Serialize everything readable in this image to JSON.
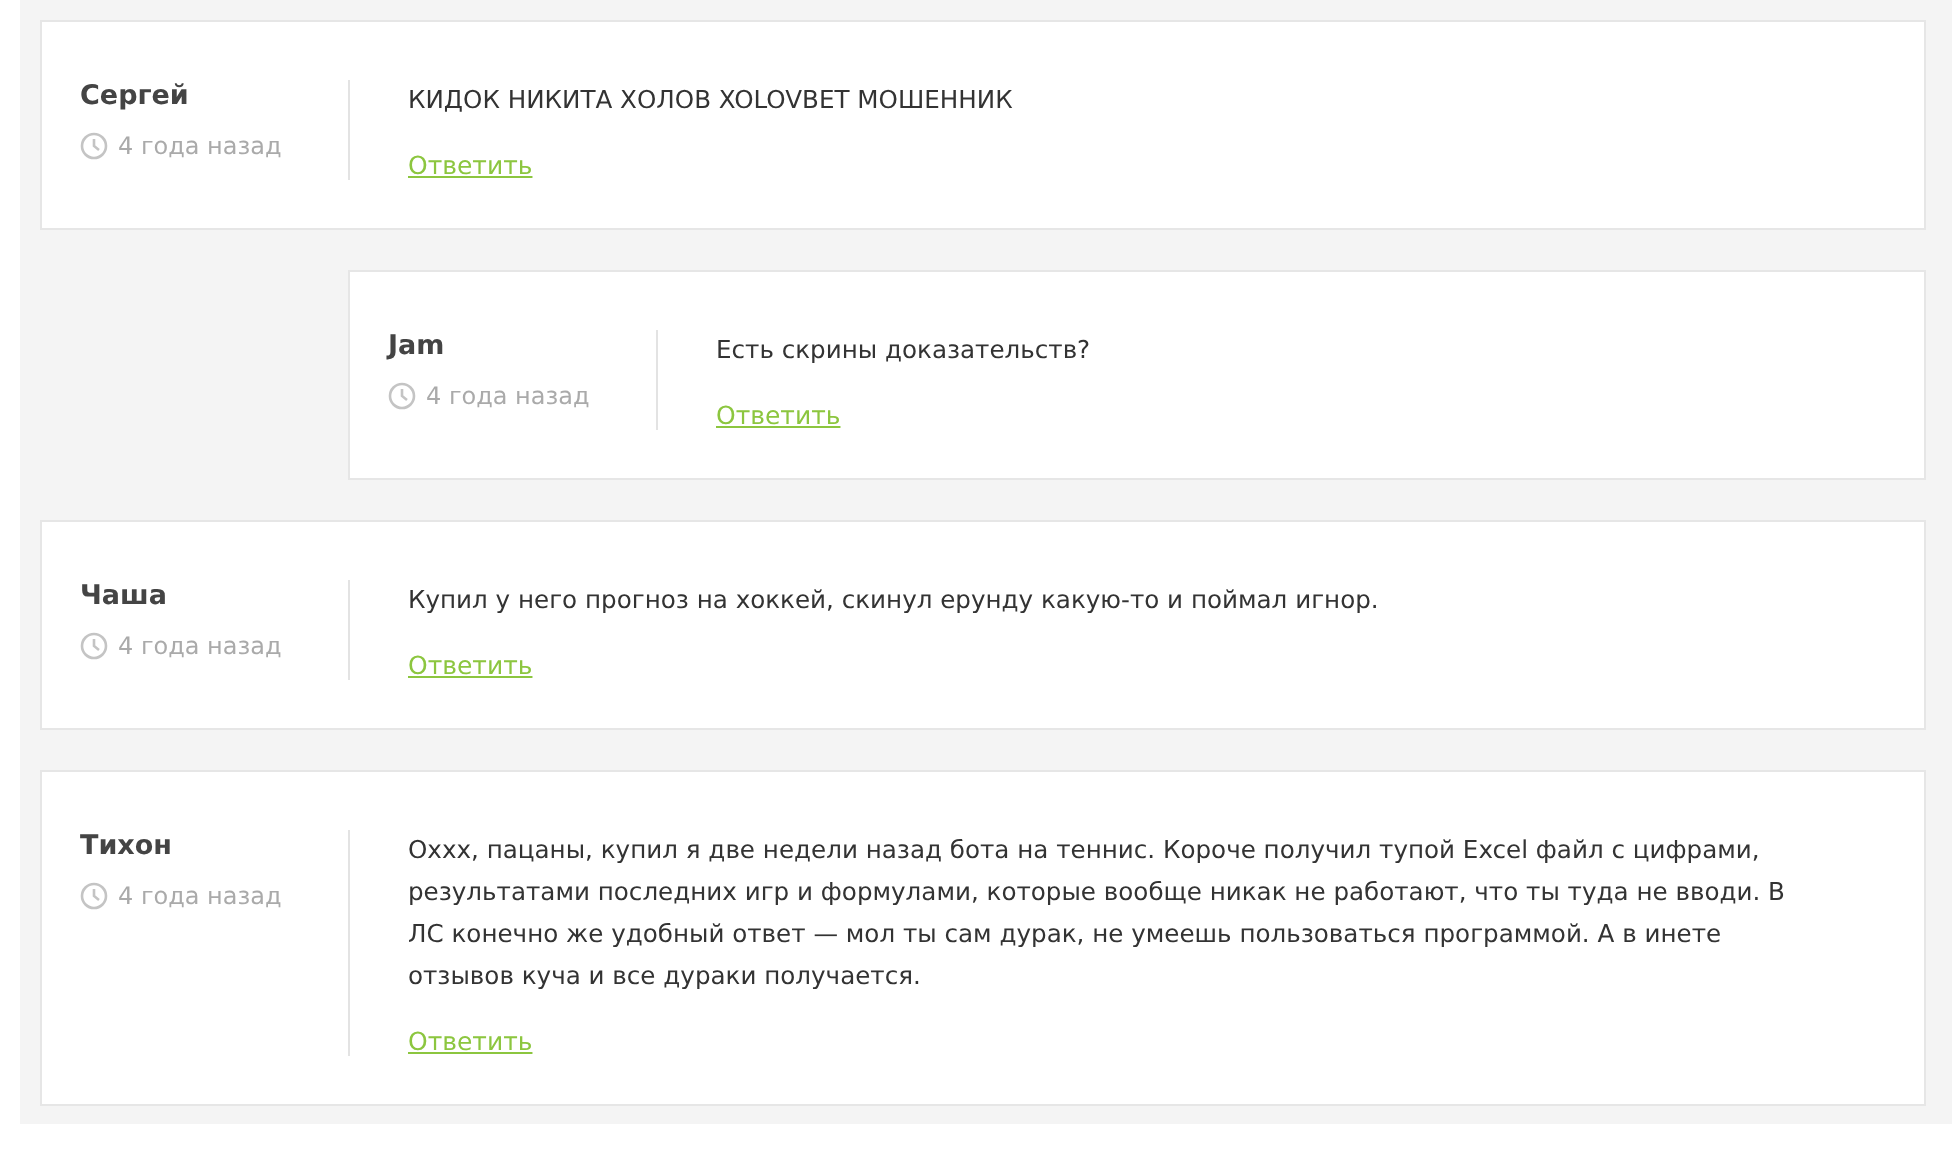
{
  "comments": [
    {
      "author": "Сергей",
      "time": "4 года назад",
      "text": "КИДОК НИКИТА ХОЛОВ XOLOVBET МОШЕННИК",
      "reply_label": "Ответить",
      "children": [
        {
          "author": "Jam",
          "time": "4 года назад",
          "text": "Есть скрины доказательств?",
          "reply_label": "Ответить"
        }
      ]
    },
    {
      "author": "Чаша",
      "time": "4 года назад",
      "text": "Купил у него прогноз на хоккей, скинул ерунду какую-то и поймал игнор.",
      "reply_label": "Ответить"
    },
    {
      "author": "Тихон",
      "time": "4 года назад",
      "text": "Оххх, пацаны, купил я две недели назад бота на теннис. Короче получил тупой Excel файл с цифрами, результатами последних игр и формулами, которые вообще никак не работают, что ты туда не вводи. В ЛС конечно же удобный ответ — мол ты сам дурак, не умеешь пользоваться программой. А в инете отзывов куча и все дураки получается.",
      "reply_label": "Ответить"
    }
  ]
}
